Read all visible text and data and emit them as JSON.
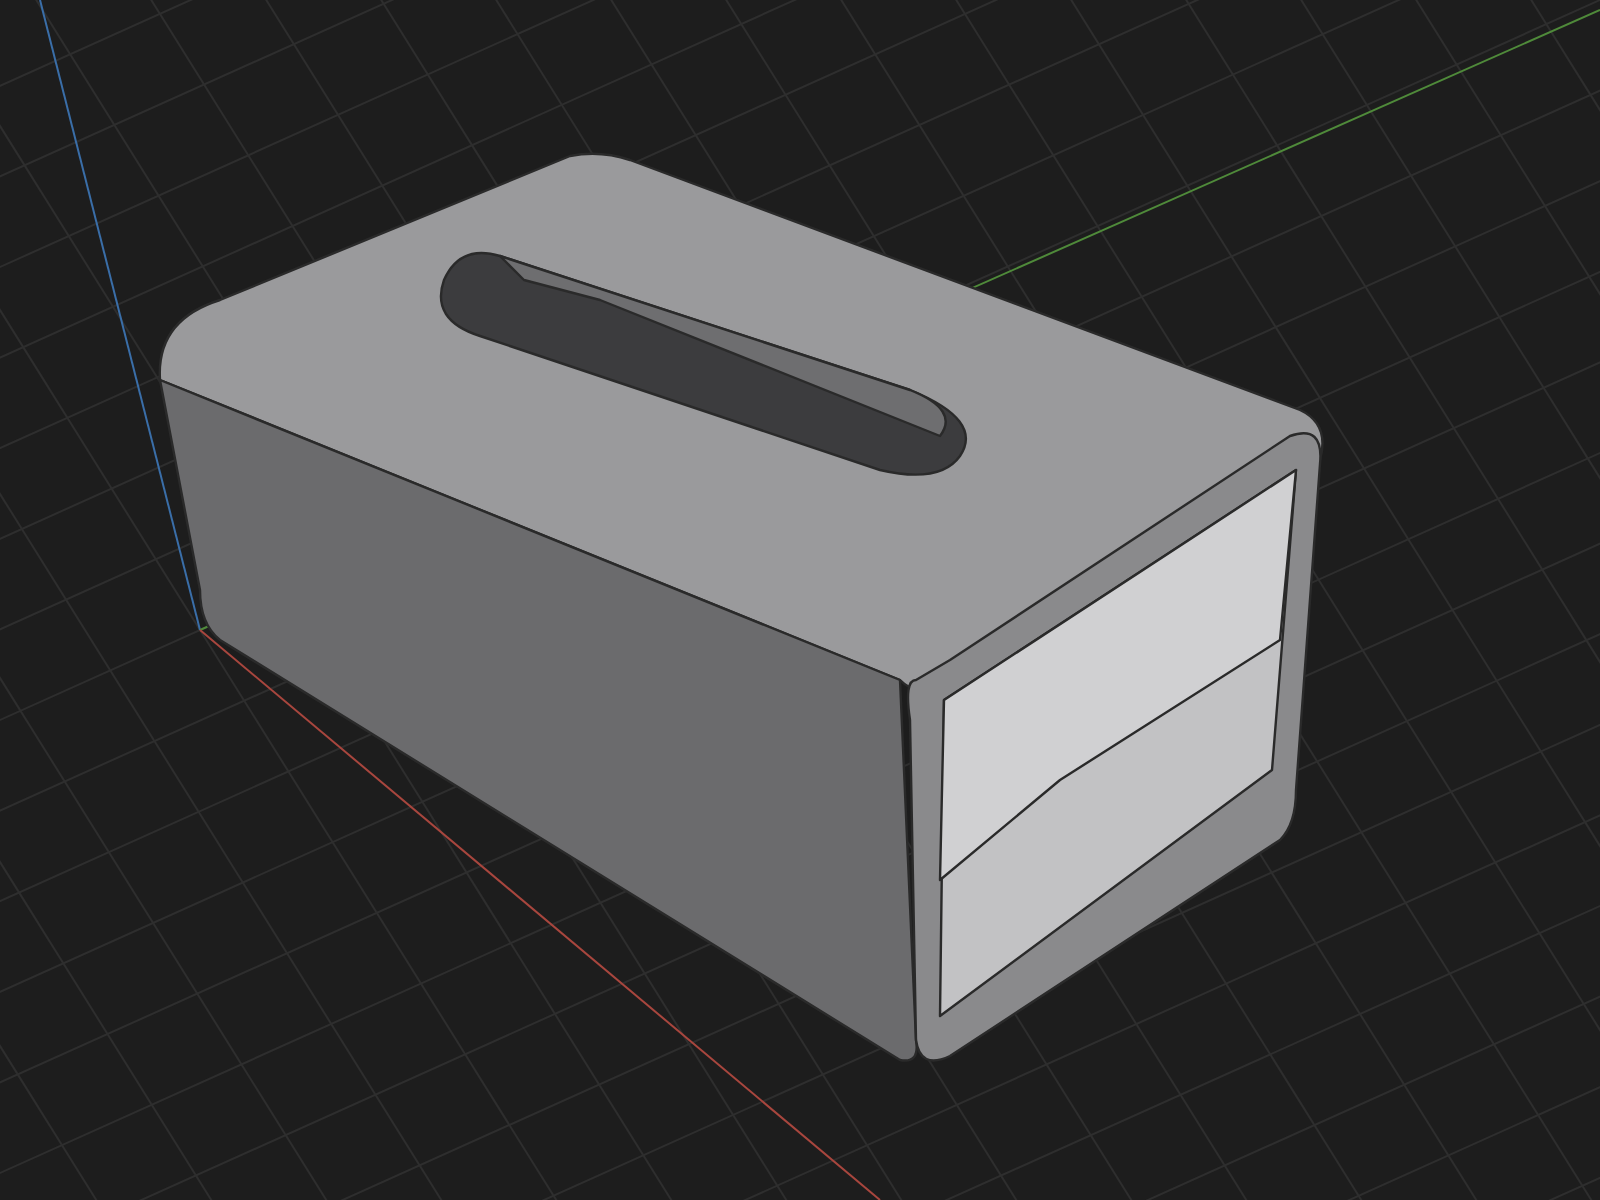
{
  "viewport": {
    "grid": true,
    "axes": true
  }
}
